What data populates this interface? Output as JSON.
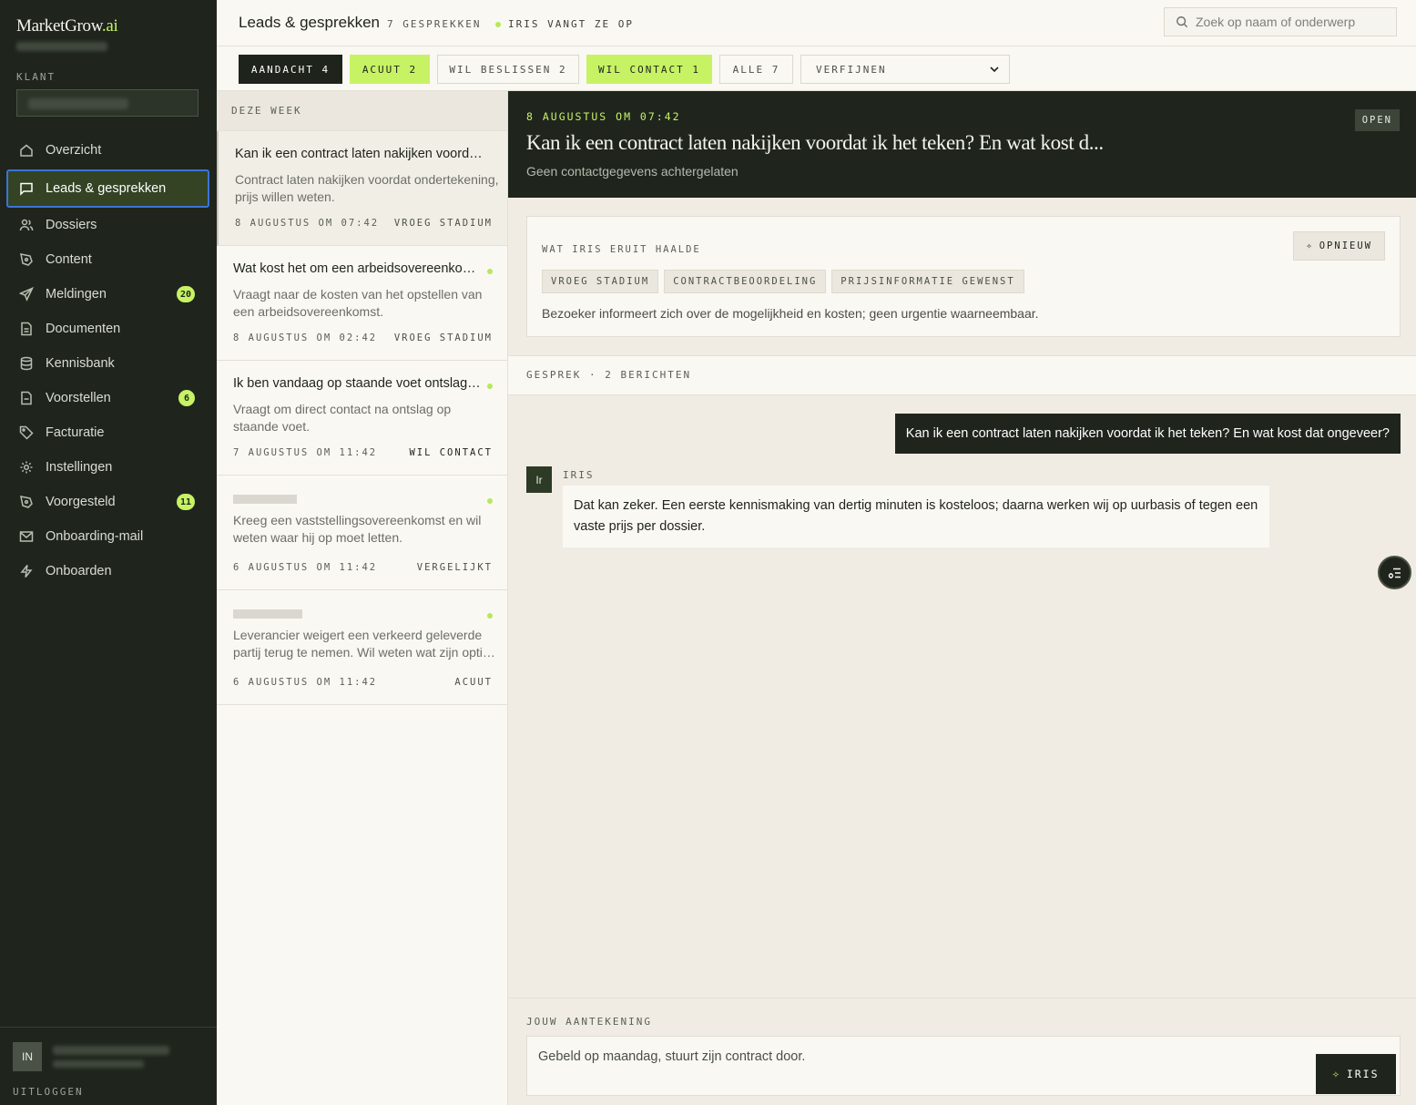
{
  "brand": {
    "name": "MarketGrow",
    "suffix": ".ai"
  },
  "sidebar": {
    "klant_label": "KLANT",
    "items": [
      {
        "label": "Overzicht",
        "icon": "home-icon"
      },
      {
        "label": "Leads & gesprekken",
        "icon": "chat-icon",
        "active": true
      },
      {
        "label": "Dossiers",
        "icon": "users-icon"
      },
      {
        "label": "Content",
        "icon": "pen-icon"
      },
      {
        "label": "Meldingen",
        "icon": "send-icon",
        "badge": "20"
      },
      {
        "label": "Documenten",
        "icon": "document-icon"
      },
      {
        "label": "Kennisbank",
        "icon": "database-icon"
      },
      {
        "label": "Voorstellen",
        "icon": "file-icon",
        "badge": "6"
      },
      {
        "label": "Facturatie",
        "icon": "tag-icon"
      },
      {
        "label": "Instellingen",
        "icon": "gear-icon"
      },
      {
        "label": "Voorgesteld",
        "icon": "pen-icon",
        "badge": "11"
      },
      {
        "label": "Onboarding-mail",
        "icon": "mail-icon"
      },
      {
        "label": "Onboarden",
        "icon": "bolt-icon"
      }
    ],
    "user_initials": "IN",
    "logout": "UITLOGGEN"
  },
  "topbar": {
    "title": "Leads & gesprekken",
    "count": "7 GESPREKKEN",
    "live": "IRIS VANGT ZE OP",
    "search_placeholder": "Zoek op naam of onderwerp"
  },
  "filters": {
    "chips": [
      {
        "label": "AANDACHT 4",
        "style": "dark"
      },
      {
        "label": "ACUUT 2",
        "style": "lime"
      },
      {
        "label": "WIL BESLISSEN 2",
        "style": "plain"
      },
      {
        "label": "WIL CONTACT 1",
        "style": "lime"
      },
      {
        "label": "ALLE 7",
        "style": "plain"
      }
    ],
    "refine": "VERFIJNEN"
  },
  "list": {
    "section": "DEZE WEEK",
    "leads": [
      {
        "title": "Kan ik een contract laten nakijken voordat ik het teken? En wat kost dat ongeveer?",
        "desc": "Contract laten nakijken voordat ondertekening, prijs willen weten.",
        "date": "8 AUGUSTUS OM 07:42",
        "stage": "VROEG STADIUM",
        "selected": true,
        "dot": false
      },
      {
        "title": "Wat kost het om een arbeidsovereenkomst te laten opstellen?",
        "desc": "Vraagt naar de kosten van het opstellen van een arbeidsovereenkomst.",
        "date": "8 AUGUSTUS OM 02:42",
        "stage": "VROEG STADIUM",
        "dot": true
      },
      {
        "title": "Ik ben vandaag op staande voet ontslagen, wat nu?",
        "desc": "Vraagt om direct contact na ontslag op staande voet.",
        "date": "7 AUGUSTUS OM 11:42",
        "stage": "WIL CONTACT",
        "dot": true,
        "strong": true
      },
      {
        "title": "",
        "desc": "Kreeg een vaststellingsovereenkomst en wil weten waar hij op moet letten.",
        "date": "6 AUGUSTUS OM 11:42",
        "stage": "VERGELIJKT",
        "dot": true
      },
      {
        "title": "",
        "desc": "Leverancier weigert een verkeerd geleverde partij terug te nemen. Wil weten wat zijn opties zijn.",
        "date": "6 AUGUSTUS OM 11:42",
        "stage": "ACUUT",
        "dot": true
      }
    ]
  },
  "detail": {
    "date": "8 AUGUSTUS OM 07:42",
    "title": "Kan ik een contract laten nakijken voordat ik het teken? En wat kost d...",
    "subtitle": "Geen contactgegevens achtergelaten",
    "status": "OPEN",
    "iris_label": "WAT IRIS ERUIT HAALDE",
    "retry": "OPNIEUW",
    "tags": [
      "VROEG STADIUM",
      "CONTRACTBEOORDELING",
      "PRIJSINFORMATIE GEWENST"
    ],
    "summary": "Bezoeker informeert zich over de mogelijkheid en kosten; geen urgentie waarneembaar.",
    "conversation_label": "GESPREK · 2 BERICHTEN",
    "user_message": "Kan ik een contract laten nakijken voordat ik het teken? En wat kost dat ongeveer?",
    "iris_avatar": "Ir",
    "iris_name": "IRIS",
    "iris_message": "Dat kan zeker. Een eerste kennismaking van dertig minuten is kosteloos; daarna werken wij op uurbasis of tegen een vaste prijs per dossier.",
    "note_label": "JOUW AANTEKENING",
    "note_value": "Gebeld op maandag, stuurt zijn contract door.",
    "iris_button": "IRIS"
  },
  "colors": {
    "sidebar": "#1f251d",
    "accent": "#c7f264",
    "focus": "#3b74d8"
  }
}
